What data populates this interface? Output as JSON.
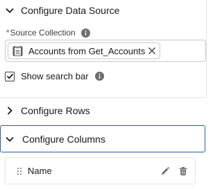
{
  "sections": {
    "data_source": {
      "title": "Configure Data Source",
      "expanded": true
    },
    "rows": {
      "title": "Configure Rows",
      "expanded": false
    },
    "columns": {
      "title": "Configure Columns",
      "expanded": true,
      "focused": true
    }
  },
  "source_collection": {
    "required_marker": "*",
    "label": "Source Collection",
    "selected_pill": "Accounts from Get_Accounts",
    "pill_icon": "collection-icon",
    "remove_icon": "close-icon"
  },
  "search_bar": {
    "label": "Show search bar",
    "checked": true
  },
  "columns": [
    {
      "name": "Name"
    }
  ],
  "colors": {
    "focus_border": "#2a5aa8",
    "required": "#c23934",
    "icon_gray": "#706e6b"
  }
}
